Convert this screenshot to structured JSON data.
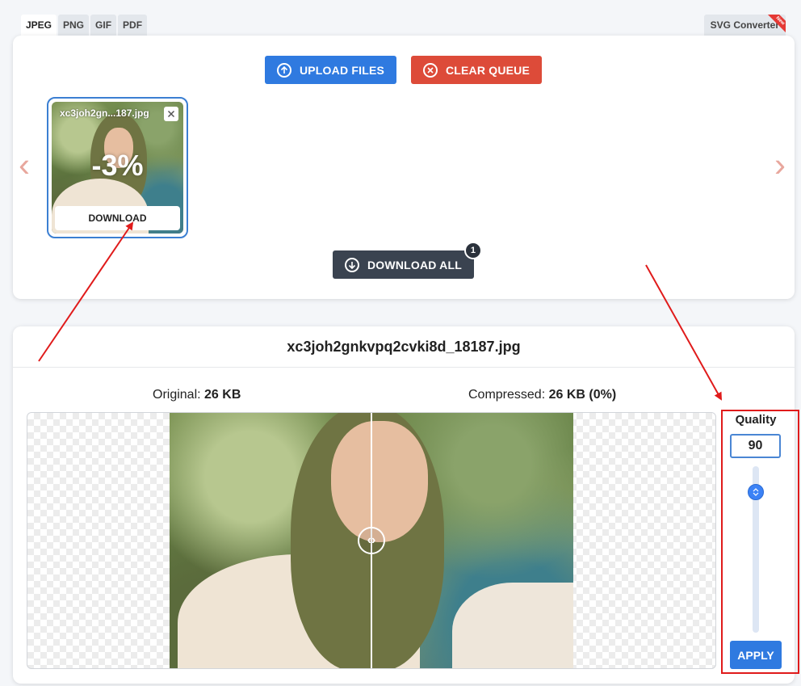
{
  "tabs": [
    {
      "label": "JPEG",
      "active": true
    },
    {
      "label": "PNG",
      "active": false
    },
    {
      "label": "GIF",
      "active": false
    },
    {
      "label": "PDF",
      "active": false
    }
  ],
  "svg_tab": {
    "label": "SVG Converter",
    "badge": "New"
  },
  "toolbar": {
    "upload_label": "UPLOAD FILES",
    "clear_label": "CLEAR QUEUE",
    "download_all_label": "DOWNLOAD ALL",
    "download_all_count": "1"
  },
  "queue": {
    "prev_arrow": "‹",
    "next_arrow": "›",
    "items": [
      {
        "filename": "xc3joh2gn...187.jpg",
        "reduction": "-3%",
        "download_label": "DOWNLOAD"
      }
    ]
  },
  "compare": {
    "filename": "xc3joh2gnkvpq2cvki8d_18187.jpg",
    "original_label": "Original:",
    "original_size": "26 KB",
    "compressed_label": "Compressed:",
    "compressed_size": "26 KB",
    "compressed_pct": "(0%)",
    "handle_glyph": "‹›"
  },
  "quality": {
    "label": "Quality",
    "value": "90",
    "slider_value": 90,
    "apply_label": "APPLY"
  },
  "colors": {
    "primary": "#2f7ae0",
    "danger": "#dd4b39",
    "dark": "#3a4350",
    "annotation": "#e01b1b"
  },
  "icons": [
    "upload-icon",
    "clear-icon",
    "download-icon",
    "close-icon",
    "compare-handle-icon",
    "slider-thumb-icon"
  ]
}
